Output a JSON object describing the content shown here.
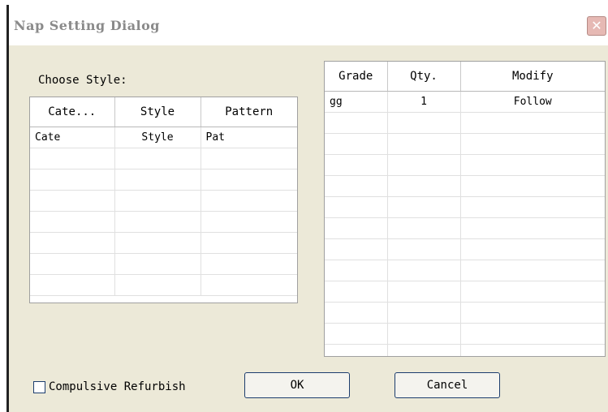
{
  "window": {
    "title": "Nap Setting Dialog",
    "close_glyph": "✕"
  },
  "left_panel": {
    "label": "Choose Style:",
    "columns": [
      "Cate...",
      "Style",
      "Pattern"
    ],
    "rows": [
      [
        "Cate",
        "Style",
        "Pat"
      ],
      [
        "",
        "",
        ""
      ],
      [
        "",
        "",
        ""
      ],
      [
        "",
        "",
        ""
      ],
      [
        "",
        "",
        ""
      ],
      [
        "",
        "",
        ""
      ],
      [
        "",
        "",
        ""
      ],
      [
        "",
        "",
        ""
      ]
    ]
  },
  "right_panel": {
    "columns": [
      "Grade",
      "Qty.",
      "Modify"
    ],
    "rows": [
      [
        "gg",
        "1",
        "Follow"
      ],
      [
        "",
        "",
        ""
      ],
      [
        "",
        "",
        ""
      ],
      [
        "",
        "",
        ""
      ],
      [
        "",
        "",
        ""
      ],
      [
        "",
        "",
        ""
      ],
      [
        "",
        "",
        ""
      ],
      [
        "",
        "",
        ""
      ],
      [
        "",
        "",
        ""
      ],
      [
        "",
        "",
        ""
      ],
      [
        "",
        "",
        ""
      ],
      [
        "",
        "",
        ""
      ],
      [
        "",
        "",
        ""
      ]
    ]
  },
  "footer": {
    "checkbox_label": "Compulsive Refurbish",
    "checkbox_checked": false,
    "ok_label": "OK",
    "cancel_label": "Cancel"
  }
}
